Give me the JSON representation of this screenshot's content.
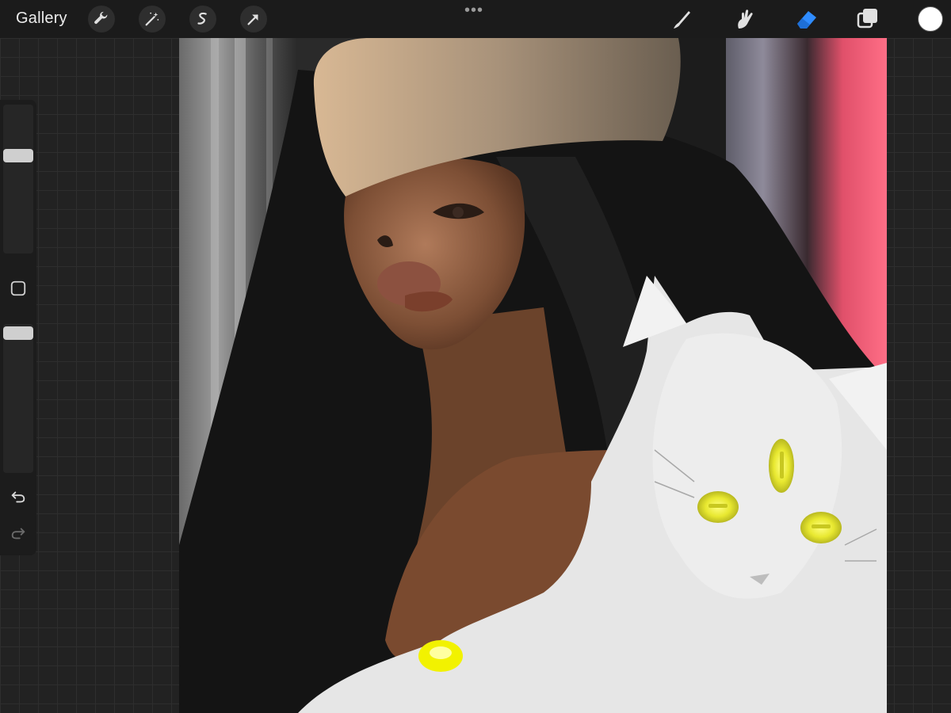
{
  "app": {
    "gallery_label": "Gallery"
  },
  "toolbar": {
    "left_tools": [
      {
        "name": "actions-wrench-icon"
      },
      {
        "name": "adjustments-magic-wand-icon"
      },
      {
        "name": "selection-icon"
      },
      {
        "name": "transform-arrow-icon"
      }
    ],
    "more_glyph": "•••",
    "right_tools": [
      {
        "name": "brush-icon",
        "active": false
      },
      {
        "name": "smudge-icon",
        "active": false
      },
      {
        "name": "eraser-icon",
        "active": true
      },
      {
        "name": "layers-icon",
        "active": false
      }
    ],
    "current_color": "#ffffff",
    "accent_color": "#2f8cff"
  },
  "sidebar": {
    "brush_size_level": 0.36,
    "opacity_level": 0.05,
    "modify_button": "square-modify-icon",
    "undo": "undo-icon",
    "redo": "redo-icon"
  }
}
